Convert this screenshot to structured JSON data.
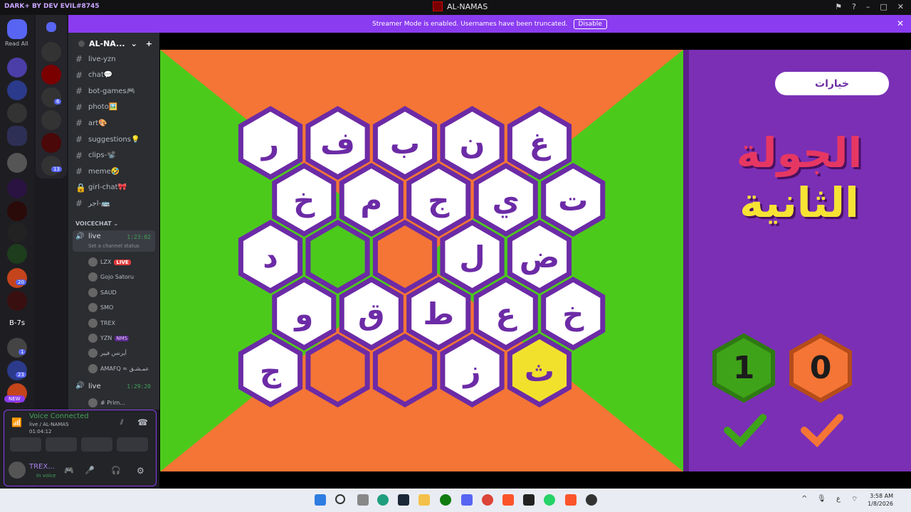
{
  "titlebar": {
    "brand": "DARK+ BY DEV EVIL#8745",
    "title": "AL-NAMAS",
    "controls": [
      "–",
      "□",
      "✕"
    ]
  },
  "guilds": {
    "read_all": "Read All",
    "b7s": "B-7s",
    "new_badge": "NEW",
    "badges": [
      "20",
      "1",
      "23"
    ],
    "folder_badges": [
      "6",
      "13"
    ]
  },
  "notice": {
    "text": "Streamer Mode is enabled. Usernames have been truncated.",
    "disable": "Disable"
  },
  "server": {
    "name": "AL-NA...",
    "channels": [
      {
        "label": "live-yzn",
        "type": "text"
      },
      {
        "label": "chat💬",
        "type": "text"
      },
      {
        "label": "bot-games🎮",
        "type": "text"
      },
      {
        "label": "photo🖼️",
        "type": "text"
      },
      {
        "label": "art🎨",
        "type": "text"
      },
      {
        "label": "suggestions💡",
        "type": "text"
      },
      {
        "label": "clips-📽️",
        "type": "text"
      },
      {
        "label": "meme🤣",
        "type": "text"
      },
      {
        "label": "girl-chat🎀",
        "type": "locked"
      },
      {
        "label": "اجر-🚌",
        "type": "text"
      }
    ],
    "voice_category": "VOICECHAT",
    "voice_channels": [
      {
        "name": "live",
        "time": "1:23:02",
        "status": "Set a channel status"
      },
      {
        "name": "live",
        "time": "1:29:20"
      }
    ],
    "voice_users": [
      {
        "name": "LZX",
        "badge": "LIVE"
      },
      {
        "name": "Gojo Satoru"
      },
      {
        "name": "SAUD"
      },
      {
        "name": "SMO"
      },
      {
        "name": "TREX"
      },
      {
        "name": "YZN",
        "badge": "NMS"
      },
      {
        "name": "أيرنس فيير"
      },
      {
        "name": "AMAFQ ≈ عمـشـق"
      },
      {
        "name": "# Prim..."
      }
    ]
  },
  "voice_panel": {
    "status": "Voice Connected",
    "channel": "live / AL-NAMAS",
    "timer": "01:04:12",
    "user": "TREX...",
    "user_status": "In voice"
  },
  "game": {
    "options_button": "خيارات",
    "round_line1": "الجولة",
    "round_line2": "الثانية",
    "scores": {
      "green": "1",
      "orange": "0"
    },
    "colors": {
      "green": "#4cca1c",
      "orange": "#f47535",
      "purple": "#6c2ba6",
      "yellow": "#f2e12c"
    },
    "grid": [
      [
        "ر",
        "ف",
        "ب",
        "ن",
        "غ"
      ],
      [
        "خ",
        "م",
        "ج",
        "ي",
        "ت"
      ],
      [
        "د",
        "",
        "",
        "ل",
        "ض"
      ],
      [
        "و",
        "ق",
        "ط",
        "ع",
        "خ"
      ],
      [
        "ج",
        "",
        "",
        "ز",
        "ث"
      ]
    ],
    "states": [
      [
        "w",
        "w",
        "w",
        "w",
        "w"
      ],
      [
        "w",
        "w",
        "w",
        "w",
        "w"
      ],
      [
        "w",
        "g",
        "o",
        "w",
        "w"
      ],
      [
        "w",
        "w",
        "w",
        "w",
        "w"
      ],
      [
        "w",
        "o",
        "o",
        "w",
        "y"
      ]
    ]
  },
  "taskbar": {
    "time": "3:58 AM",
    "date": "1/8/2026",
    "lang": "ع"
  }
}
